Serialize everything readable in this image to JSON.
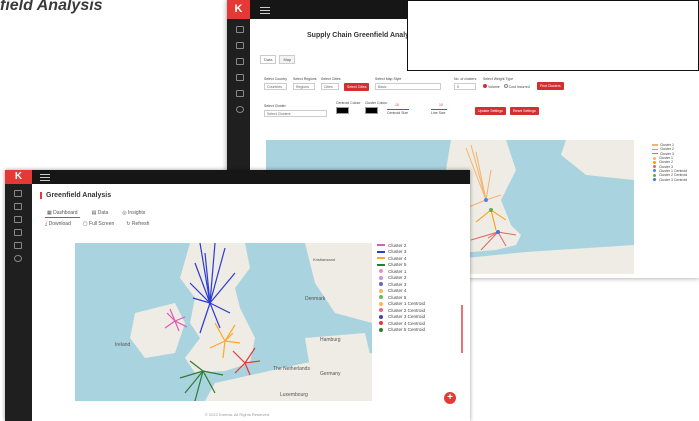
{
  "page": {
    "title": "field Analysis"
  },
  "front_window": {
    "logo": "K",
    "heading": "Greenfield Analysis",
    "tabs": [
      {
        "icon": "grid-icon",
        "label": "Dashboard"
      },
      {
        "icon": "table-icon",
        "label": "Data"
      },
      {
        "icon": "lightbulb-icon",
        "label": "Insights"
      }
    ],
    "tools": [
      {
        "icon": "download-icon",
        "label": "Download"
      },
      {
        "icon": "fullscreen-icon",
        "label": "Full Screen"
      },
      {
        "icon": "refresh-icon",
        "label": "Refresh"
      }
    ],
    "map_labels": {
      "ireland": "Ireland",
      "denmark": "Denmark",
      "hamburg": "Hamburg",
      "netherlands": "The Netherlands",
      "germany": "Germany",
      "luxembourg": "Luxembourg",
      "kristiansand": "Kristiansand"
    },
    "legend": [
      {
        "label": "Cluster 2",
        "kind": "line",
        "color": "#e05ab4"
      },
      {
        "label": "Cluster 3",
        "kind": "line",
        "color": "#2a3bd6"
      },
      {
        "label": "Cluster 4",
        "kind": "line",
        "color": "#ffa726"
      },
      {
        "label": "Cluster 5",
        "kind": "line",
        "color": "#2e7d32"
      },
      {
        "label": "Cluster 1",
        "kind": "dot",
        "color": "#f48fb1"
      },
      {
        "label": "Cluster 2",
        "kind": "dot",
        "color": "#ce93d8"
      },
      {
        "label": "Cluster 3",
        "kind": "dot",
        "color": "#5c6bc0"
      },
      {
        "label": "Cluster 4",
        "kind": "dot",
        "color": "#ffb74d"
      },
      {
        "label": "Cluster 5",
        "kind": "dot",
        "color": "#66bb6a"
      },
      {
        "label": "Cluster 1 Centroid",
        "kind": "dot",
        "color": "#ffb74d"
      },
      {
        "label": "Cluster 2 Centroid",
        "kind": "dot",
        "color": "#f06292"
      },
      {
        "label": "Cluster 3 Centroid",
        "kind": "dot",
        "color": "#3949ab"
      },
      {
        "label": "Cluster 4 Centroid",
        "kind": "dot",
        "color": "#e53935"
      },
      {
        "label": "Cluster 5 Centroid",
        "kind": "dot",
        "color": "#2e7d32"
      }
    ],
    "fab": "+",
    "footer": "© 2022 Kreeda. All Rights Reserved."
  },
  "back_window": {
    "logo": "K",
    "heading": "Supply Chain Greenfield Analysis",
    "tabs": [
      "Data",
      "Map"
    ],
    "controls": {
      "country_label": "Select Country",
      "country_value": "Countries",
      "region_label": "Select Regions",
      "region_value": "Regions",
      "city_label": "Select Cities",
      "city_value": "Cities",
      "basemap_label": "Select Map Style",
      "basemap_value": "Basic",
      "k_label": "No. of clusters",
      "k_value": "5",
      "weight_label": "Select Weight Type",
      "weight_opt1": "Volume",
      "weight_opt2": "Cost Incurred",
      "cluster_label": "Select Cluster",
      "cluster_placeholder": "Select Clusters",
      "centroid_color_label": "Centroid Colour",
      "cluster_color_label": "Cluster Colour",
      "centroid_size_label": "Centroid Size",
      "centroid_size_value": "10",
      "line_size_label": "Line Size",
      "line_size_value": "10"
    },
    "buttons": {
      "select_cities": "Select Cities",
      "find_clusters": "Find Clusters",
      "update_settings": "Update Settings",
      "reset_settings": "Reset Settings"
    },
    "legend": [
      {
        "label": "Cluster 1",
        "kind": "line",
        "color": "#f6b26b"
      },
      {
        "label": "Cluster 2",
        "kind": "line",
        "color": "#ff9900"
      },
      {
        "label": "Cluster 3",
        "kind": "line",
        "color": "#e06666"
      },
      {
        "label": "Cluster 1",
        "kind": "dot",
        "color": "#f6b26b"
      },
      {
        "label": "Cluster 2",
        "kind": "dot",
        "color": "#ff9900"
      },
      {
        "label": "Cluster 3",
        "kind": "dot",
        "color": "#e06666"
      },
      {
        "label": "Cluster 1 Centroid",
        "kind": "dot",
        "color": "#4a86e8"
      },
      {
        "label": "Cluster 2 Centroid",
        "kind": "dot",
        "color": "#6aa84f"
      },
      {
        "label": "Cluster 3 Centroid",
        "kind": "dot",
        "color": "#3c78d8"
      }
    ]
  },
  "colors": {
    "accent": "#e53935",
    "sidebar": "#1f1f1f",
    "map_water": "#a9d3df",
    "map_land": "#eeece4",
    "arrow": "#1e8a1e"
  }
}
